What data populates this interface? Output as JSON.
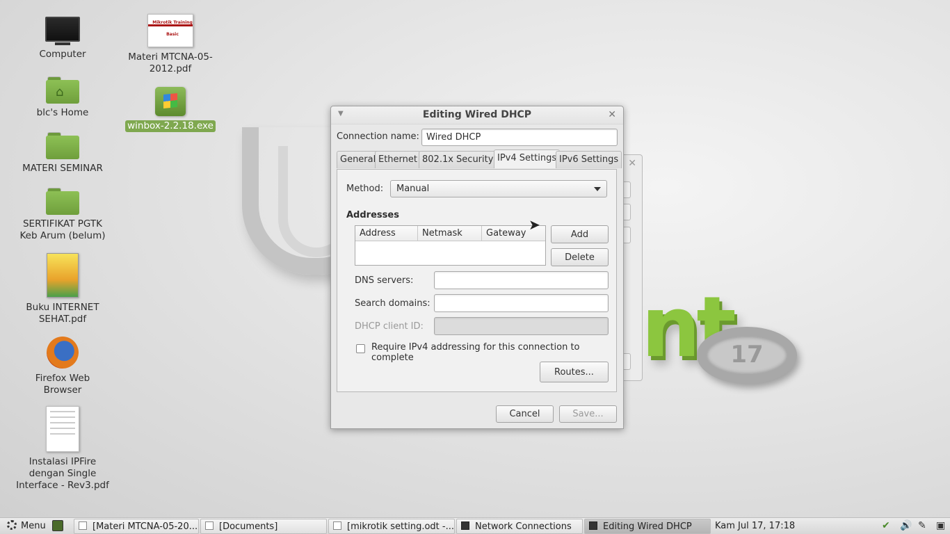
{
  "desktop": {
    "icons": [
      {
        "label": "Computer",
        "icon": "monitor-icon"
      },
      {
        "label": "blc's Home",
        "icon": "home-folder-icon"
      },
      {
        "label": "MATERI SEMINAR",
        "icon": "folder-icon"
      },
      {
        "label": "SERTIFIKAT PGTK Keb Arum (belum)",
        "icon": "folder-icon"
      },
      {
        "label": "Buku INTERNET SEHAT.pdf",
        "icon": "pdf-book-icon"
      },
      {
        "label": "Firefox Web Browser",
        "icon": "firefox-icon"
      },
      {
        "label": "Instalasi IPFire dengan Single Interface - Rev3.pdf",
        "icon": "pdf-document-icon"
      },
      {
        "label": "Materi MTCNA-05-2012.pdf",
        "icon": "pdf-slide-icon",
        "thumb_title": "Mikrotik Training Basic"
      },
      {
        "label": "winbox-2.2.18.exe",
        "icon": "exe-icon"
      }
    ]
  },
  "dialog": {
    "title": "Editing Wired DHCP",
    "connection_name_label": "Connection name:",
    "connection_name_value": "Wired DHCP",
    "tabs": [
      {
        "label": "General",
        "active": false
      },
      {
        "label": "Ethernet",
        "active": false
      },
      {
        "label": "802.1x Security",
        "active": false
      },
      {
        "label": "IPv4 Settings",
        "active": true
      },
      {
        "label": "IPv6 Settings",
        "active": false
      }
    ],
    "method_label": "Method:",
    "method_value": "Manual",
    "addresses_heading": "Addresses",
    "address_columns": [
      "Address",
      "Netmask",
      "Gateway"
    ],
    "add_label": "Add",
    "delete_label": "Delete",
    "dns_label": "DNS servers:",
    "dns_value": "",
    "search_label": "Search domains:",
    "search_value": "",
    "dhcp_id_label": "DHCP client ID:",
    "dhcp_id_value": "",
    "require_ipv4_label": "Require IPv4 addressing for this connection to complete",
    "require_ipv4_checked": false,
    "routes_label": "Routes...",
    "cancel_label": "Cancel",
    "save_label": "Save..."
  },
  "taskbar": {
    "menu_label": "Menu",
    "items": [
      {
        "label": "[Materi MTCNA-05-20...",
        "active": false
      },
      {
        "label": "[Documents]",
        "active": false
      },
      {
        "label": "[mikrotik setting.odt -...",
        "active": false
      },
      {
        "label": "Network Connections",
        "active": false
      },
      {
        "label": "Editing Wired DHCP",
        "active": true
      }
    ],
    "clock": "Kam Jul 17, 17:18"
  },
  "wallpaper": {
    "version": "17"
  },
  "colors": {
    "accent": "#7fa84f",
    "mint_green": "#8cc63f"
  }
}
